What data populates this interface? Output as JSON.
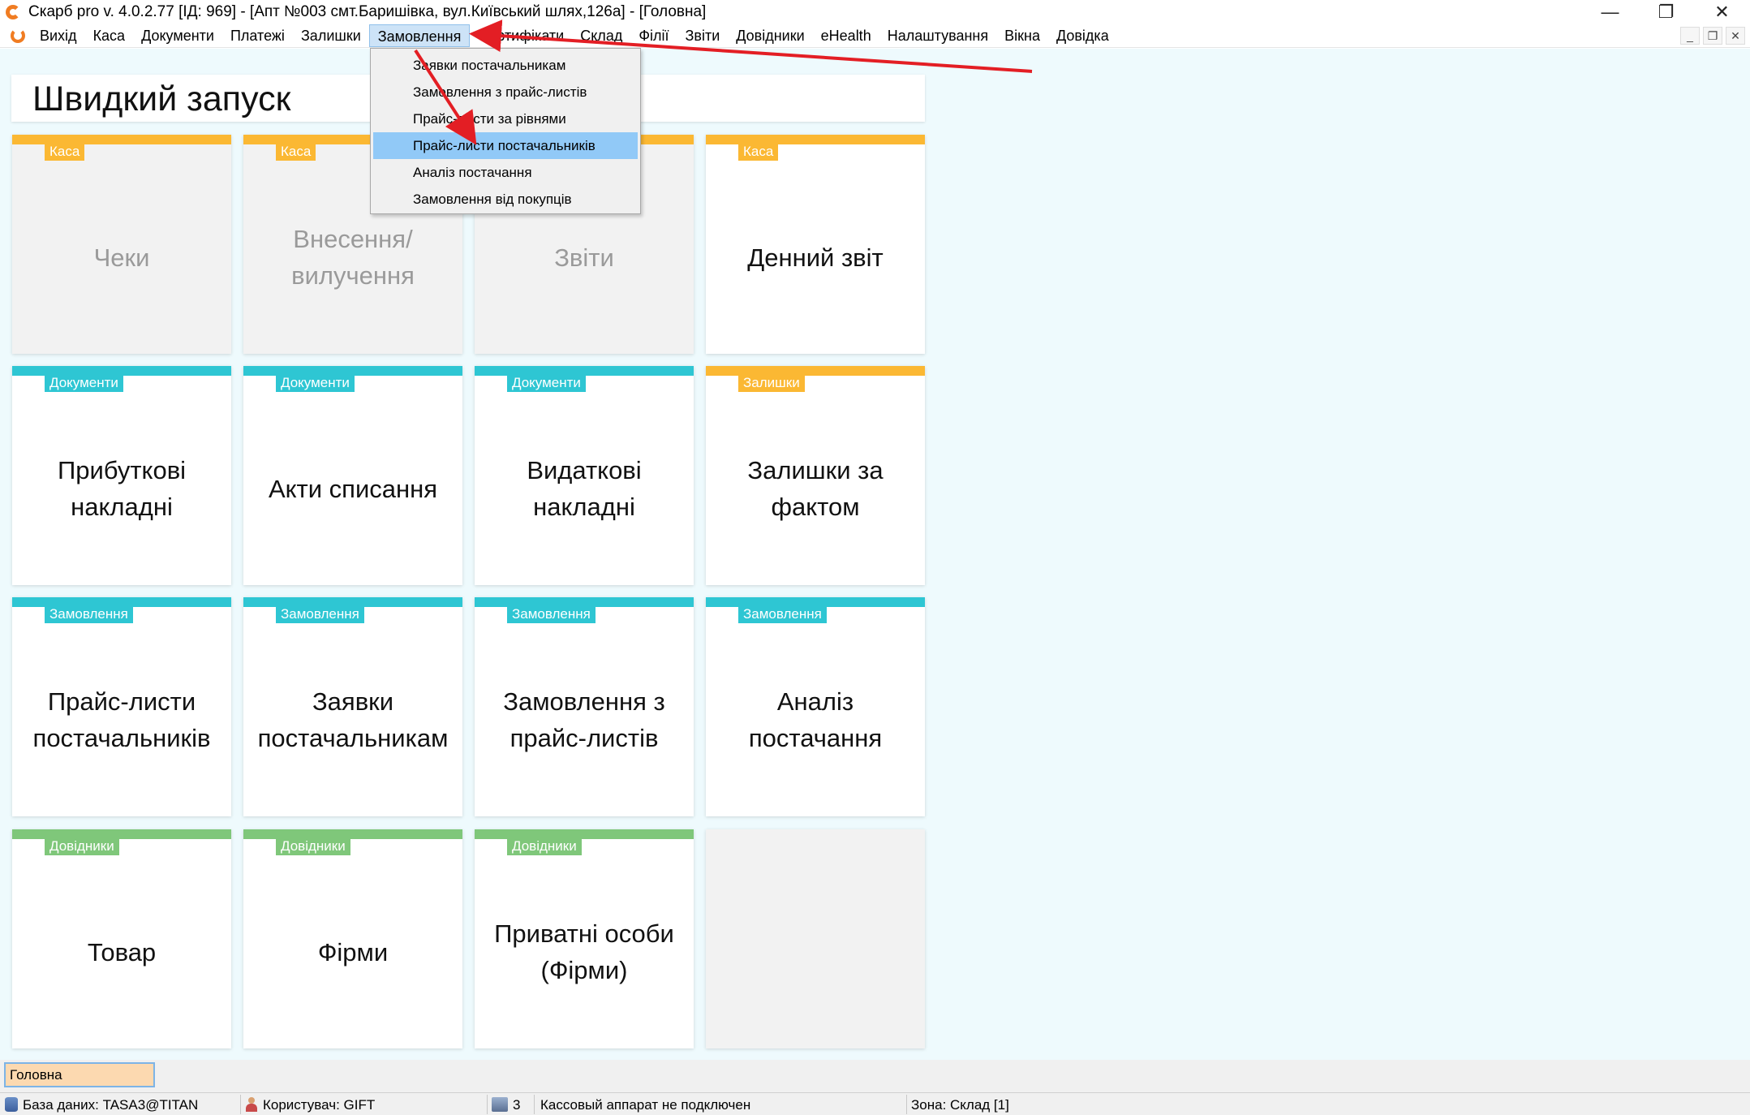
{
  "titlebar": {
    "title": "Скарб pro v. 4.0.2.77 [ІД: 969] - [Апт №003 смт.Баришівка, вул.Київський шлях,126а] - [Головна]",
    "minimize": "—",
    "restore": "❐",
    "close": "✕",
    "logo_icon": "skarb-logo-icon"
  },
  "menubar": {
    "items": [
      "Вихід",
      "Каса",
      "Документи",
      "Платежі",
      "Залишки",
      "Замовлення",
      "Сертифікати",
      "Склад",
      "Філії",
      "Звіти",
      "Довідники",
      "eHealth",
      "Налаштування",
      "Вікна",
      "Довідка"
    ],
    "active_index": 5,
    "mdi_minimize": "_",
    "mdi_restore": "❐",
    "mdi_close": "✕"
  },
  "dropdown": {
    "items": [
      "Заявки постачальникам",
      "Замовлення з прайс-листів",
      "Прайс-листи за рівнями",
      "Прайс-листи постачальників",
      "Аналіз постачання",
      "Замовлення від покупців"
    ],
    "highlighted_index": 3
  },
  "quick_launch": {
    "title": "Швидкий запуск",
    "colors": {
      "kasa": "#fbb833",
      "documents": "#2ec6d3",
      "remains": "#fbb833",
      "orders": "#2ec6d3",
      "directories": "#7fc77a"
    },
    "tiles": [
      {
        "category": "Каса",
        "label": "Чеки",
        "state": "disabled"
      },
      {
        "category": "Каса",
        "label": "Внесення/вилучення",
        "state": "disabled"
      },
      {
        "category": "Каса",
        "label": "Звіти",
        "state": "disabled"
      },
      {
        "category": "Каса",
        "label": "Денний звіт",
        "state": "enabled"
      },
      {
        "category": "Документи",
        "label": "Прибуткові накладні",
        "state": "enabled"
      },
      {
        "category": "Документи",
        "label": "Акти списання",
        "state": "enabled"
      },
      {
        "category": "Документи",
        "label": "Видаткові накладні",
        "state": "enabled"
      },
      {
        "category": "Залишки",
        "label": "Залишки за фактом",
        "state": "enabled"
      },
      {
        "category": "Замовлення",
        "label": "Прайс-листи постачальників",
        "state": "enabled"
      },
      {
        "category": "Замовлення",
        "label": "Заявки постачальникам",
        "state": "enabled"
      },
      {
        "category": "Замовлення",
        "label": "Замовлення з прайс-листів",
        "state": "enabled"
      },
      {
        "category": "Замовлення",
        "label": "Аналіз постачання",
        "state": "enabled"
      },
      {
        "category": "Довідники",
        "label": "Товар",
        "state": "enabled"
      },
      {
        "category": "Довідники",
        "label": "Фірми",
        "state": "enabled"
      },
      {
        "category": "Довідники",
        "label": "Приватні особи (Фірми)",
        "state": "enabled"
      }
    ]
  },
  "annotation_color": "#e31e24",
  "tabs": {
    "home": "Головна"
  },
  "statusbar": {
    "database": "База даних: TASA3@TITAN",
    "user": "Користувач: GIFT",
    "cash_count": "3",
    "cash_status": "Кассовый аппарат не подключен",
    "zone": "Зона: Склад [1]"
  }
}
